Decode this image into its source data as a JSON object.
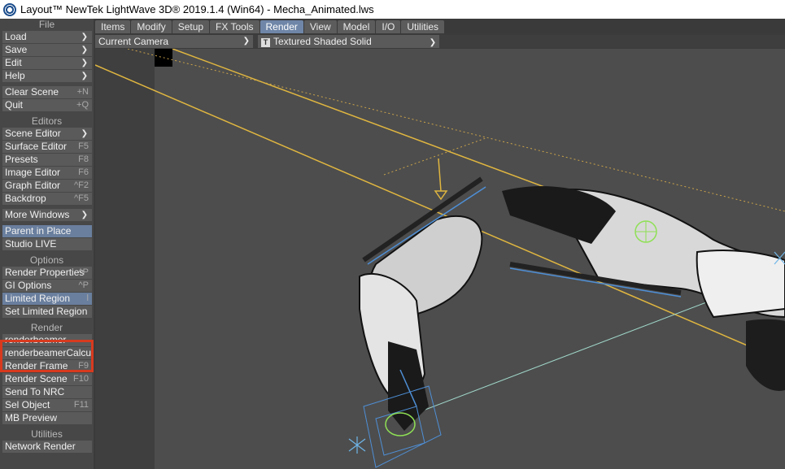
{
  "window": {
    "title": "Layout™ NewTek LightWave 3D® 2019.1.4 (Win64) - Mecha_Animated.lws"
  },
  "tabs": [
    "Items",
    "Modify",
    "Setup",
    "FX Tools",
    "Render",
    "View",
    "Model",
    "I/O",
    "Utilities"
  ],
  "active_tab": "Render",
  "viewport": {
    "camera": "Current Camera",
    "shading_icon": "T",
    "shading": "Textured Shaded Solid"
  },
  "sidebar": {
    "file": {
      "header": "File",
      "load": "Load",
      "save": "Save",
      "edit": "Edit",
      "help": "Help",
      "clear_scene": "Clear Scene",
      "clear_scene_sc": "+N",
      "quit": "Quit",
      "quit_sc": "+Q"
    },
    "editors": {
      "header": "Editors",
      "scene_editor": "Scene Editor",
      "surface_editor": "Surface Editor",
      "surface_editor_sc": "F5",
      "presets": "Presets",
      "presets_sc": "F8",
      "image_editor": "Image Editor",
      "image_editor_sc": "F6",
      "graph_editor": "Graph Editor",
      "graph_editor_sc": "^F2",
      "backdrop": "Backdrop",
      "backdrop_sc": "^F5",
      "more_windows": "More Windows",
      "parent_in_place": "Parent in Place",
      "studio_live": "Studio LIVE"
    },
    "options": {
      "header": "Options",
      "render_properties": "Render Properties",
      "render_properties_sc": "^P",
      "gi_options": "GI Options",
      "gi_options_sc": "^P",
      "limited_region": "Limited Region",
      "limited_region_sc": "l",
      "set_limited_region": "Set Limited Region"
    },
    "render": {
      "header": "Render",
      "renderbeamer": "renderbeamer",
      "renderbeamer_calc": "renderbeamerCalcul...",
      "render_frame": "Render Frame",
      "render_frame_sc": "F9",
      "render_scene": "Render Scene",
      "render_scene_sc": "F10",
      "send_to_nrc": "Send To NRC",
      "sel_object": "Sel Object",
      "sel_object_sc": "F11",
      "mb_preview": "MB Preview"
    },
    "utilities": {
      "header": "Utilities",
      "network_render": "Network Render"
    }
  }
}
